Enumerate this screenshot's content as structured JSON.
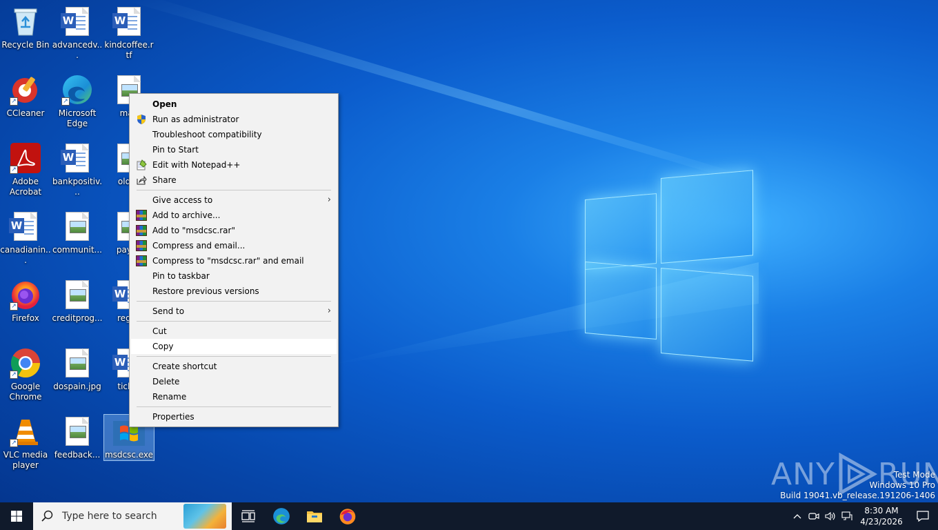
{
  "desktop": {
    "icons": [
      {
        "label": "Recycle Bin"
      },
      {
        "label": "advancedv..."
      },
      {
        "label": "kindcoffee.rtf"
      },
      {
        "label": "CCleaner"
      },
      {
        "label": "Microsoft Edge"
      },
      {
        "label": "man"
      },
      {
        "label": "Adobe Acrobat"
      },
      {
        "label": "bankpositiv..."
      },
      {
        "label": "oldsh"
      },
      {
        "label": "canadianin..."
      },
      {
        "label": "communit..."
      },
      {
        "label": "paych"
      },
      {
        "label": "Firefox"
      },
      {
        "label": "creditprog..."
      },
      {
        "label": "regist"
      },
      {
        "label": "Google Chrome"
      },
      {
        "label": "dospain.jpg"
      },
      {
        "label": "ticket"
      },
      {
        "label": "VLC media player"
      },
      {
        "label": "feedback..."
      },
      {
        "label": "msdcsc.exe"
      }
    ]
  },
  "context_menu": {
    "items": [
      {
        "label": "Open"
      },
      {
        "label": "Run as administrator"
      },
      {
        "label": "Troubleshoot compatibility"
      },
      {
        "label": "Pin to Start"
      },
      {
        "label": "Edit with Notepad++"
      },
      {
        "label": "Share"
      },
      {
        "label": "Give access to"
      },
      {
        "label": "Add to archive..."
      },
      {
        "label": "Add to \"msdcsc.rar\""
      },
      {
        "label": "Compress and email..."
      },
      {
        "label": "Compress to \"msdcsc.rar\" and email"
      },
      {
        "label": "Pin to taskbar"
      },
      {
        "label": "Restore previous versions"
      },
      {
        "label": "Send to"
      },
      {
        "label": "Cut"
      },
      {
        "label": "Copy"
      },
      {
        "label": "Create shortcut"
      },
      {
        "label": "Delete"
      },
      {
        "label": "Rename"
      },
      {
        "label": "Properties"
      }
    ]
  },
  "taskbar": {
    "search_placeholder": "Type here to search",
    "time": "8:30 AM",
    "date": "4/23/2026"
  },
  "system_info": {
    "line1": "Test Mode",
    "line2": "Windows 10 Pro",
    "line3": "Build 19041.vb_release.191206-1406"
  },
  "watermark": {
    "text_left": "ANY",
    "text_right": "RUN"
  }
}
